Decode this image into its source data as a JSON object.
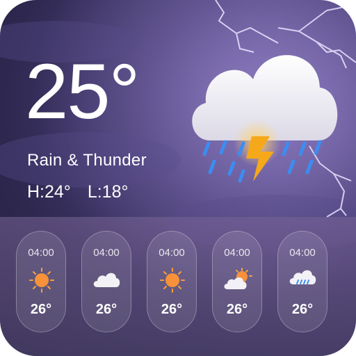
{
  "current": {
    "temperature": "25°",
    "condition": "Rain & Thunder",
    "high": "H:24°",
    "low": "L:18°",
    "icon": "cloud-rain-thunder-icon"
  },
  "forecast": [
    {
      "time": "04:00",
      "temp": "26°",
      "icon": "sun-icon"
    },
    {
      "time": "04:00",
      "temp": "26°",
      "icon": "cloud-icon"
    },
    {
      "time": "04:00",
      "temp": "26°",
      "icon": "sun-icon"
    },
    {
      "time": "04:00",
      "temp": "26°",
      "icon": "partly-cloudy-icon"
    },
    {
      "time": "04:00",
      "temp": "26°",
      "icon": "cloud-rain-icon"
    }
  ],
  "colors": {
    "background": "#3a3263",
    "sun": "#f7913a",
    "rain": "#3c8df0",
    "lightning": "#f5a91a"
  }
}
